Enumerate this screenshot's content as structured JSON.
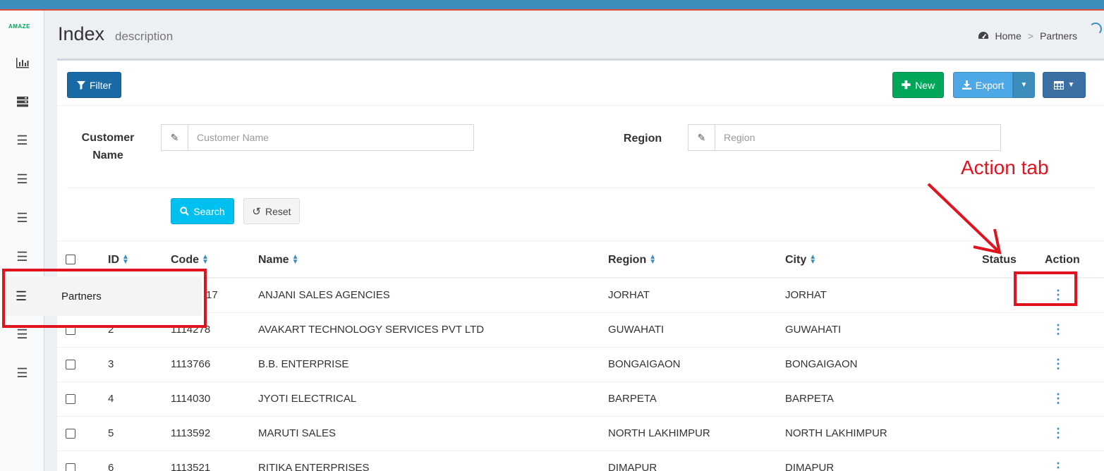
{
  "sidebar": {
    "logo": "AMAZE",
    "icons": [
      "bar-chart-icon",
      "server-icon",
      "bars-icon",
      "bars-icon",
      "bars-icon",
      "bars-icon",
      "bars-icon",
      "bars-icon"
    ],
    "hover_item_label": "Partners"
  },
  "header": {
    "title": "Index",
    "description": "description",
    "breadcrumb": [
      "Home",
      "Partners"
    ]
  },
  "toolbar": {
    "filter_label": "Filter",
    "new_label": "New",
    "export_label": "Export"
  },
  "filters": {
    "customer_label": "Customer Name",
    "customer_placeholder": "Customer Name",
    "customer_value": "",
    "region_label": "Region",
    "region_placeholder": "Region",
    "region_value": "",
    "search_label": "Search",
    "reset_label": "Reset"
  },
  "table": {
    "columns": [
      "ID",
      "Code",
      "Name",
      "Region",
      "City",
      "Status",
      "Action"
    ],
    "rows": [
      {
        "id": "",
        "code": "17",
        "name": "ANJANI SALES AGENCIES",
        "region": "JORHAT",
        "city": "JORHAT",
        "status": ""
      },
      {
        "id": "2",
        "code": "1114278",
        "name": "AVAKART TECHNOLOGY SERVICES PVT LTD",
        "region": "GUWAHATI",
        "city": "GUWAHATI",
        "status": ""
      },
      {
        "id": "3",
        "code": "1113766",
        "name": "B.B. ENTERPRISE",
        "region": "BONGAIGAON",
        "city": "BONGAIGAON",
        "status": ""
      },
      {
        "id": "4",
        "code": "1114030",
        "name": "JYOTI ELECTRICAL",
        "region": "BARPETA",
        "city": "BARPETA",
        "status": ""
      },
      {
        "id": "5",
        "code": "1113592",
        "name": "MARUTI SALES",
        "region": "NORTH LAKHIMPUR",
        "city": "NORTH LAKHIMPUR",
        "status": ""
      },
      {
        "id": "6",
        "code": "1113521",
        "name": "RITIKA ENTERPRISES",
        "region": "DIMAPUR",
        "city": "DIMAPUR",
        "status": ""
      }
    ]
  },
  "annotation": {
    "label": "Action tab",
    "color": "#e0141e"
  },
  "colors": {
    "primary": "#3c8dbc",
    "success": "#00a65a",
    "info": "#00c0ef"
  }
}
